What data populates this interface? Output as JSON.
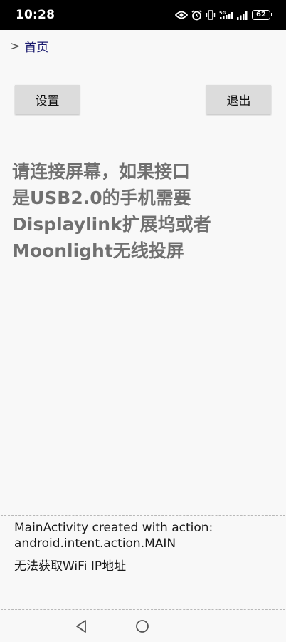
{
  "status_bar": {
    "time": "10:28",
    "network_label": "5G",
    "battery_level": "62",
    "icons": [
      "eye-icon",
      "alarm-icon",
      "vibrate-icon",
      "5g-signal-icon",
      "signal-icon",
      "battery-icon"
    ]
  },
  "breadcrumb": {
    "separator": ">",
    "home_label": "首页"
  },
  "buttons": {
    "settings_label": "设置",
    "exit_label": "退出"
  },
  "message": {
    "lines": [
      "请连接屏幕，如果接口",
      "是USB2.0的手机需要",
      "Displaylink扩展坞或者",
      "Moonlight无线投屏"
    ]
  },
  "log": {
    "line1": "MainActivity created with action: android.intent.action.MAIN",
    "line2": "无法获取WiFi IP地址"
  },
  "nav_bar": {
    "icons": [
      "back-triangle-icon",
      "home-circle-icon"
    ]
  },
  "colors": {
    "status_bar_bg": "#000000",
    "background": "#f8f8f8",
    "button_bg": "#dcdcdc",
    "message_text": "#707070",
    "breadcrumb_link": "#1a1a6e"
  }
}
